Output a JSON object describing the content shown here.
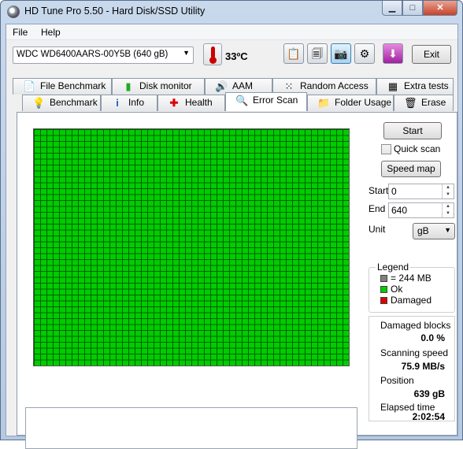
{
  "window": {
    "title": "HD Tune Pro 5.50 - Hard Disk/SSD Utility"
  },
  "menu": {
    "items": [
      "File",
      "Help"
    ]
  },
  "toolbar": {
    "drive": "WDC    WD6400AARS-00Y5B (640 gB)",
    "temperature": "33ºC",
    "exit_label": "Exit",
    "buttons": [
      "copy-info-icon",
      "copy-screenshot-icon",
      "camera-icon",
      "settings-icon",
      "download-icon"
    ]
  },
  "tabs": {
    "row1": [
      "File Benchmark",
      "Disk monitor",
      "AAM",
      "Random Access",
      "Extra tests"
    ],
    "row2": [
      "Benchmark",
      "Info",
      "Health",
      "Error Scan",
      "Folder Usage",
      "Erase"
    ],
    "selected": "Error Scan"
  },
  "controls": {
    "start_label": "Start",
    "quick_scan_label": "Quick scan",
    "quick_scan_checked": false,
    "speed_map_label": "Speed map",
    "start_field_label": "Start",
    "start_value": "0",
    "end_field_label": "End",
    "end_value": "640",
    "unit_label": "Unit",
    "unit_value": "gB"
  },
  "legend": {
    "title": "Legend",
    "block_size": "= 244 MB",
    "ok": "Ok",
    "damaged": "Damaged",
    "colors": {
      "block": "#808080",
      "ok": "#00cc00",
      "damaged": "#dd0000"
    }
  },
  "stats": {
    "damaged_blocks_label": "Damaged blocks",
    "damaged_blocks_value": "0.0 %",
    "scanning_speed_label": "Scanning speed",
    "scanning_speed_value": "75.9 MB/s",
    "position_label": "Position",
    "position_value": "639 gB",
    "elapsed_label": "Elapsed time",
    "elapsed_value": "2:02:54"
  }
}
